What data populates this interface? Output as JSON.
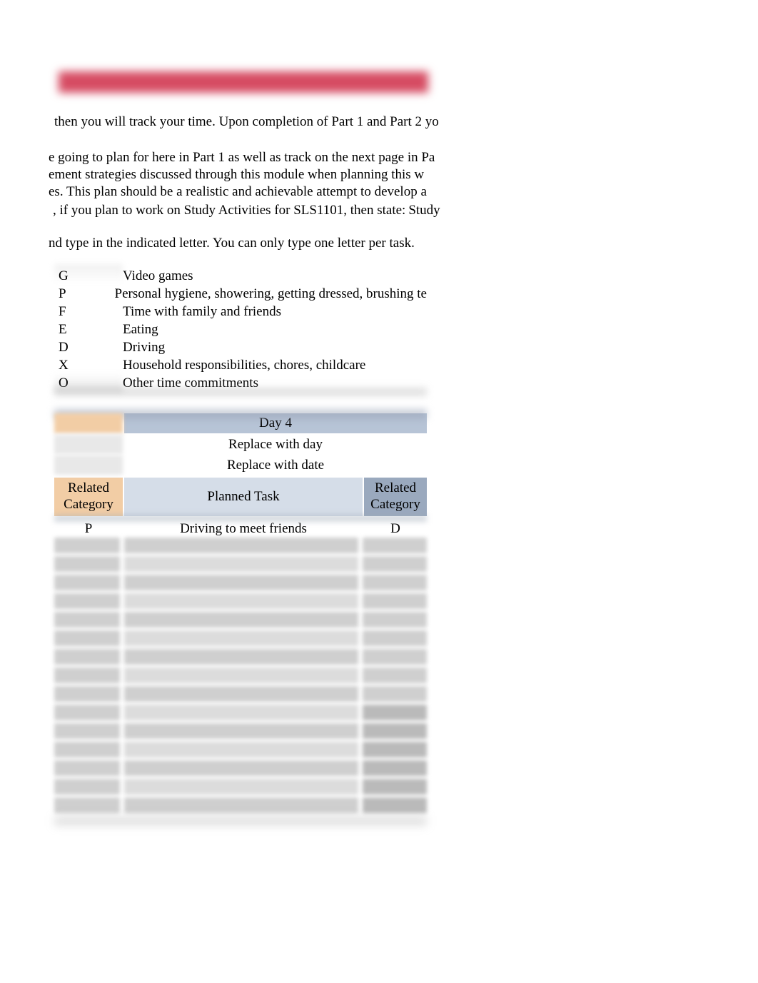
{
  "paragraphs": {
    "p1": "then you will track your time. Upon completion of Part 1 and Part 2 yo",
    "p2": "e going to plan for here in Part 1 as well as track on the next page in Pa",
    "p3": "ement strategies discussed through this module when planning this w",
    "p4": "es. This plan should be a realistic and achievable attempt to develop a",
    "p5a": ", if you plan to work on Study Activities for SLS1101, then state:",
    "p5b": "Study",
    "p6": "nd type in the indicated letter. You can only type one letter per task."
  },
  "legend": [
    {
      "code": "G",
      "desc": "Video games"
    },
    {
      "code": "P",
      "desc": "Personal hygiene, showering, getting dressed, brushing te"
    },
    {
      "code": "F",
      "desc": "Time with family and friends"
    },
    {
      "code": "E",
      "desc": "Eating"
    },
    {
      "code": "D",
      "desc": "Driving"
    },
    {
      "code": "X",
      "desc": "Household responsibilities, chores, childcare"
    },
    {
      "code": "O",
      "desc": "Other time commitments"
    }
  ],
  "schedule": {
    "day_label": "Day 4",
    "day_placeholder": "Replace with day",
    "date_placeholder": "Replace with date",
    "headers": {
      "related_category_left": "Related Category",
      "planned_task": "Planned Task",
      "related_category_right": "Related Category"
    },
    "rows": [
      {
        "left_cat": "P",
        "task": "Driving to meet friends",
        "right_cat": "D"
      }
    ],
    "blurred_row_count": 15
  }
}
